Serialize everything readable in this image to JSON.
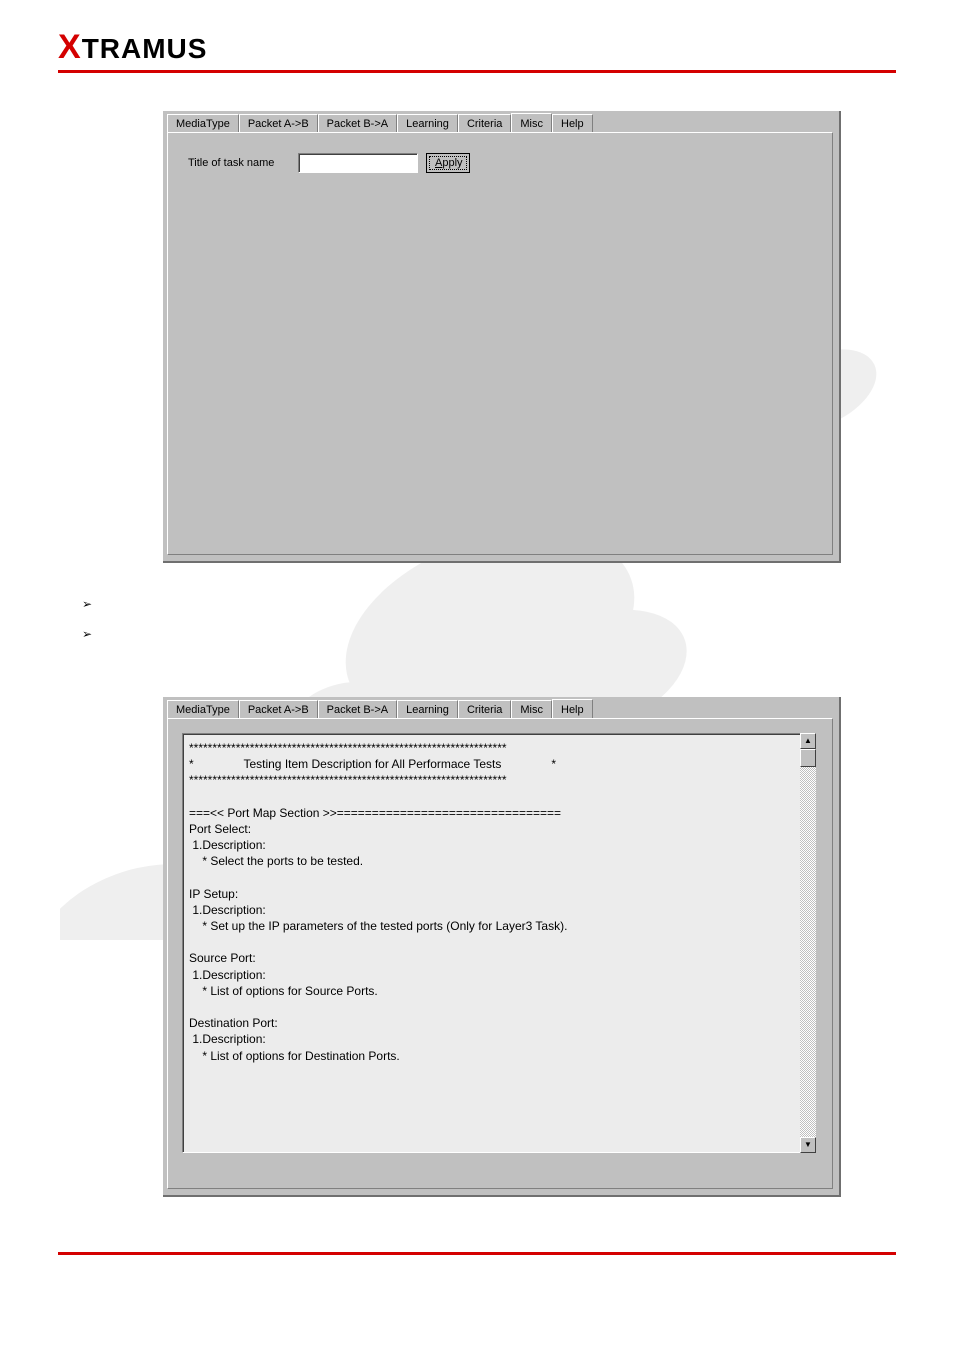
{
  "brand": {
    "name": "XTRAMUS"
  },
  "tabs": [
    {
      "id": "mediatype",
      "label": "MediaType"
    },
    {
      "id": "packetab",
      "label": "Packet A->B"
    },
    {
      "id": "packetba",
      "label": "Packet B->A"
    },
    {
      "id": "learning",
      "label": "Learning"
    },
    {
      "id": "criteria",
      "label": "Criteria"
    },
    {
      "id": "misc",
      "label": "Misc"
    },
    {
      "id": "help",
      "label": "Help"
    }
  ],
  "panel1": {
    "active_tab": "misc",
    "title_label": "Title of task name",
    "title_value": "",
    "apply_label": "Apply"
  },
  "panel2": {
    "active_tab": "help",
    "help_text": "********************************************************************\n*               Testing Item Description for All Performace Tests               *\n********************************************************************\n\n===<< Port Map Section >>================================\nPort Select:\n 1.Description:\n    * Select the ports to be tested.\n\nIP Setup:\n 1.Description:\n    * Set up the IP parameters of the tested ports (Only for Layer3 Task).\n\nSource Port:\n 1.Description:\n    * List of options for Source Ports.\n\nDestination Port:\n 1.Description:\n    * List of options for Destination Ports."
  },
  "bullets": {
    "glyph": "➢"
  }
}
